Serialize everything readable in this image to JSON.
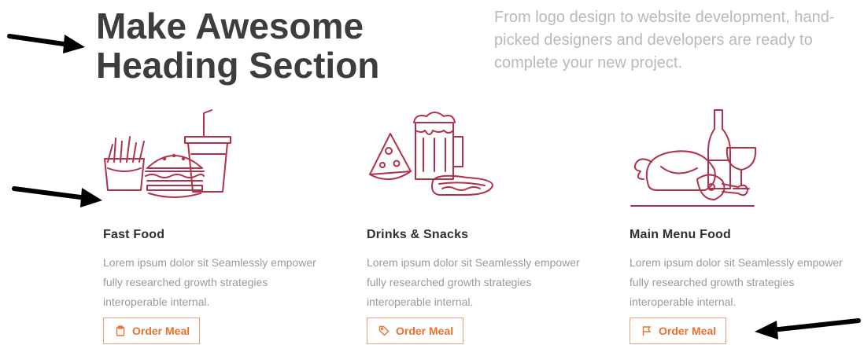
{
  "hero": {
    "heading_line1": "Make Awesome",
    "heading_line2": "Heading Section",
    "intro": "From logo design to website development, hand-picked designers and developers are ready to complete your new project."
  },
  "cards": [
    {
      "title": "Fast Food",
      "description": "Lorem ipsum dolor sit Seamlessly empower fully researched growth strategies interoperable internal.",
      "button_label": "Order Meal",
      "button_icon": "clipboard-icon",
      "illustration": "fast-food-illustration"
    },
    {
      "title": "Drinks & Snacks",
      "description": "Lorem ipsum dolor sit Seamlessly empower fully researched growth strategies interoperable internal.",
      "button_label": "Order Meal",
      "button_icon": "tag-icon",
      "illustration": "drinks-snacks-illustration"
    },
    {
      "title": "Main Menu Food",
      "description": "Lorem ipsum dolor sit Seamlessly empower fully researched growth strategies interoperable internal.",
      "button_label": "Order Meal",
      "button_icon": "flag-icon",
      "illustration": "main-menu-food-illustration"
    }
  ],
  "colors": {
    "heading": "#3d3d40",
    "intro": "#b9b9b9",
    "illustration": "#b0324a",
    "button_accent": "#e8722f",
    "button_border": "#f0a476",
    "arrow": "#000000"
  }
}
